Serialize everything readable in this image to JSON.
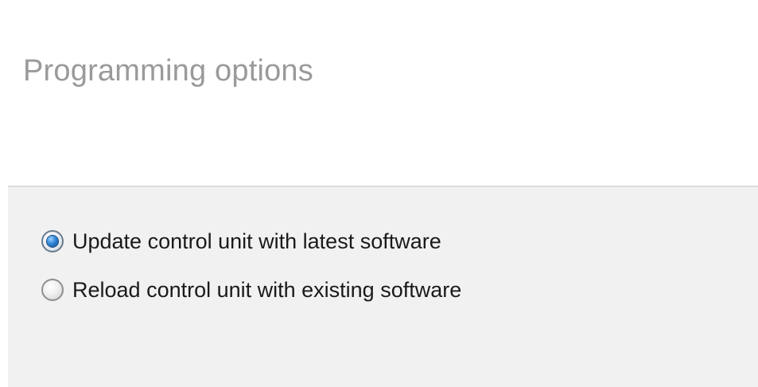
{
  "page": {
    "title": "Programming options"
  },
  "options": [
    {
      "label": "Update control unit with latest software",
      "selected": true
    },
    {
      "label": "Reload control unit with existing software",
      "selected": false
    }
  ],
  "colors": {
    "title_text": "#9a9a9a",
    "panel_background": "#f1f1f1",
    "panel_border": "#dcdcdc",
    "radio_selected": "#2f86d6",
    "label_text": "#1a1a1a"
  }
}
